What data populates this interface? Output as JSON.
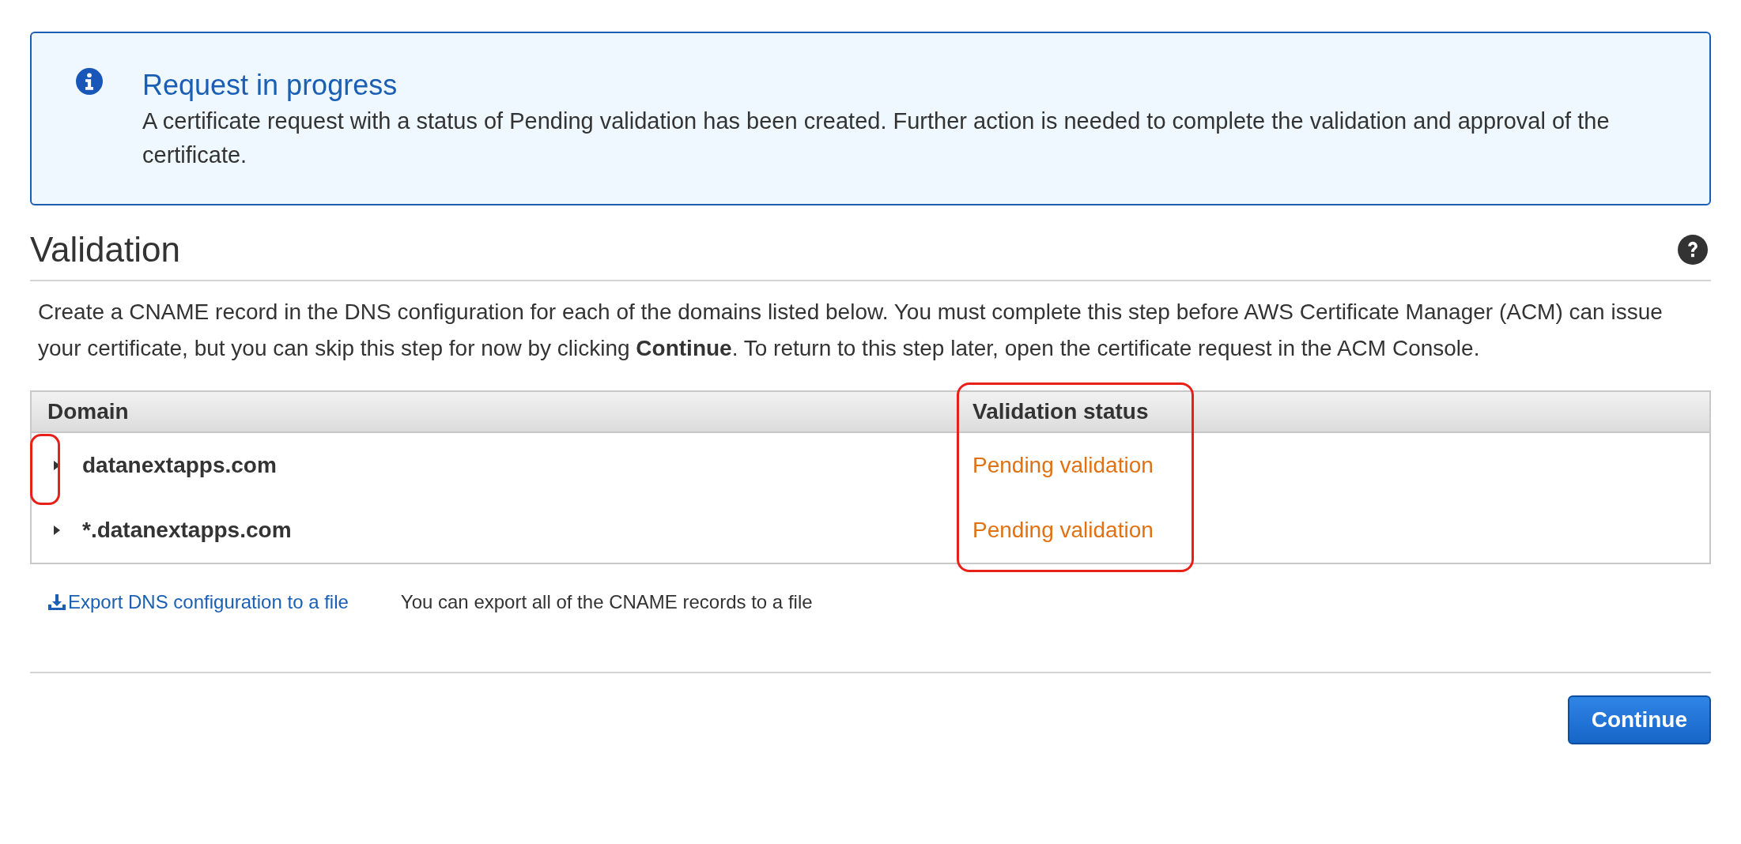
{
  "alert": {
    "kind": "info",
    "title": "Request in progress",
    "message": "A certificate request with a status of Pending validation has been created. Further action is needed to complete the validation and approval of the certificate."
  },
  "section": {
    "title": "Validation",
    "description": "Create a CNAME record in the DNS configuration for each of the domains listed below. You must complete this step before AWS Certificate Manager (ACM) can issue your certificate, but you can skip this step for now by clicking **Continue**. To return to this step later, open the certificate request in the ACM Console."
  },
  "table": {
    "columns": [
      {
        "label": "Domain",
        "highlighted": false
      },
      {
        "label": "Validation status",
        "highlighted": true
      }
    ],
    "rows": [
      {
        "domain": "datanextapps.com",
        "status": "Pending validation",
        "expanded": false,
        "toggle_highlighted": true
      },
      {
        "domain": "*.datanextapps.com",
        "status": "Pending validation",
        "expanded": false,
        "toggle_highlighted": false
      }
    ]
  },
  "export": {
    "link": "Export DNS configuration to a file",
    "hint": "You can export all of the CNAME records to a file"
  },
  "buttons": [
    {
      "label": "Continue",
      "kind": "primary"
    }
  ]
}
